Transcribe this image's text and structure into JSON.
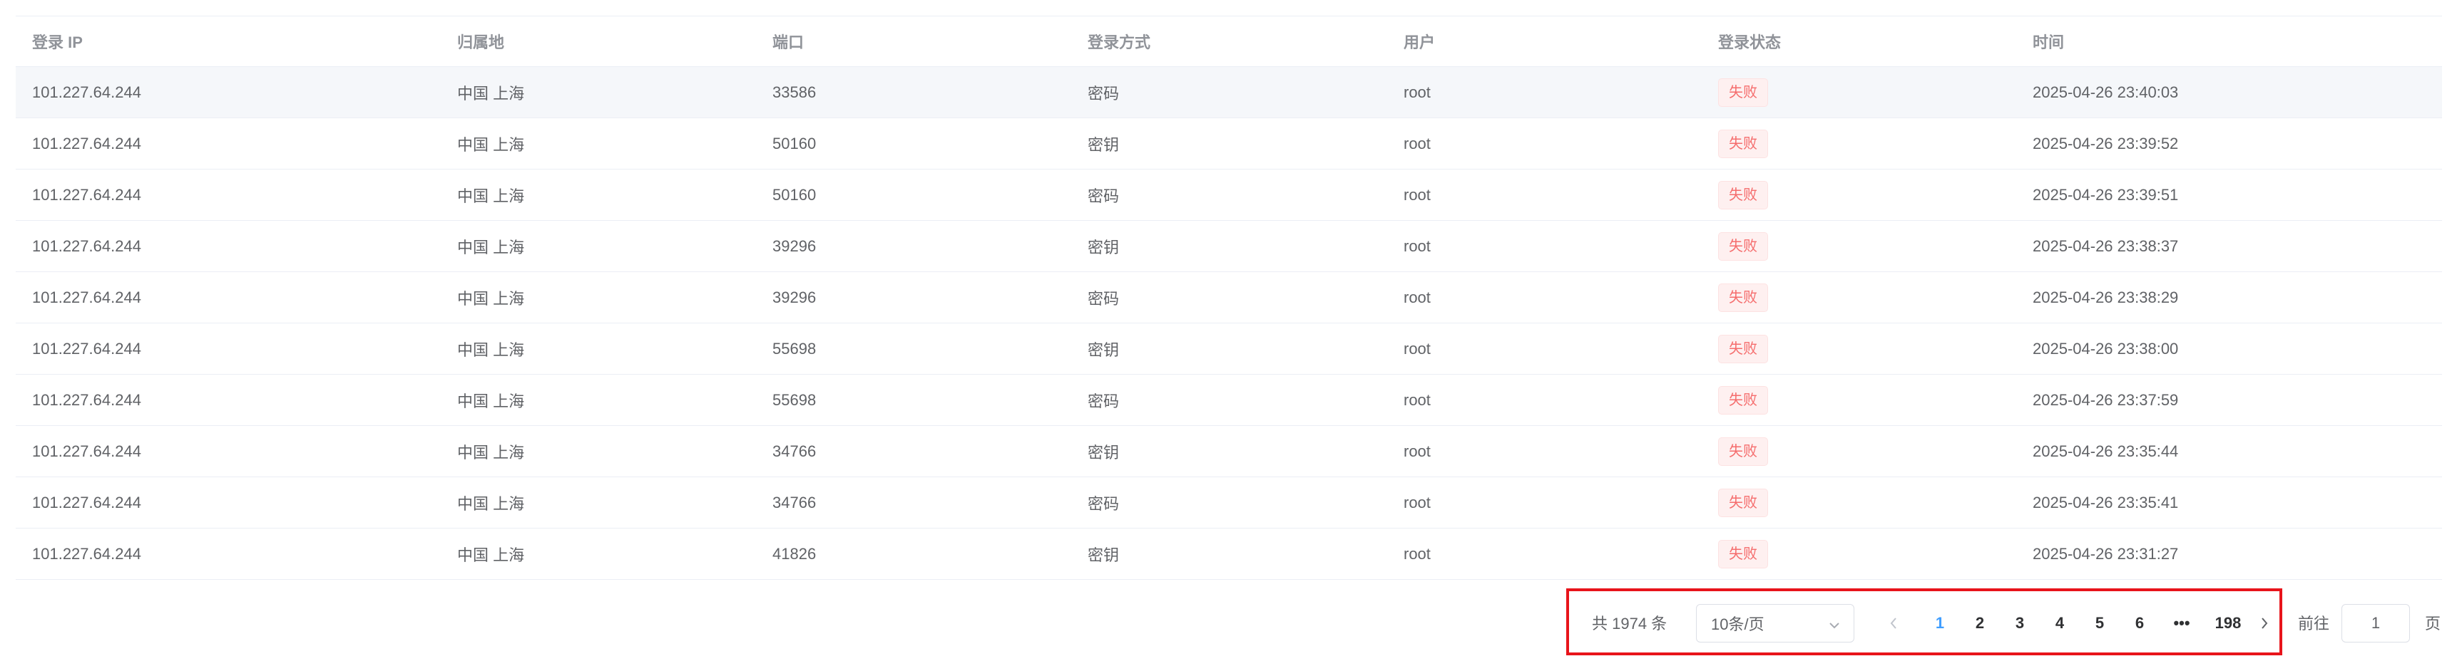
{
  "table": {
    "columns": [
      "登录 IP",
      "归属地",
      "端口",
      "登录方式",
      "用户",
      "登录状态",
      "时间"
    ],
    "rows": [
      {
        "ip": "101.227.64.244",
        "location": "中国 上海",
        "port": "33586",
        "method": "密码",
        "user": "root",
        "status": "失败",
        "time": "2025-04-26 23:40:03"
      },
      {
        "ip": "101.227.64.244",
        "location": "中国 上海",
        "port": "50160",
        "method": "密钥",
        "user": "root",
        "status": "失败",
        "time": "2025-04-26 23:39:52"
      },
      {
        "ip": "101.227.64.244",
        "location": "中国 上海",
        "port": "50160",
        "method": "密码",
        "user": "root",
        "status": "失败",
        "time": "2025-04-26 23:39:51"
      },
      {
        "ip": "101.227.64.244",
        "location": "中国 上海",
        "port": "39296",
        "method": "密钥",
        "user": "root",
        "status": "失败",
        "time": "2025-04-26 23:38:37"
      },
      {
        "ip": "101.227.64.244",
        "location": "中国 上海",
        "port": "39296",
        "method": "密码",
        "user": "root",
        "status": "失败",
        "time": "2025-04-26 23:38:29"
      },
      {
        "ip": "101.227.64.244",
        "location": "中国 上海",
        "port": "55698",
        "method": "密钥",
        "user": "root",
        "status": "失败",
        "time": "2025-04-26 23:38:00"
      },
      {
        "ip": "101.227.64.244",
        "location": "中国 上海",
        "port": "55698",
        "method": "密码",
        "user": "root",
        "status": "失败",
        "time": "2025-04-26 23:37:59"
      },
      {
        "ip": "101.227.64.244",
        "location": "中国 上海",
        "port": "34766",
        "method": "密钥",
        "user": "root",
        "status": "失败",
        "time": "2025-04-26 23:35:44"
      },
      {
        "ip": "101.227.64.244",
        "location": "中国 上海",
        "port": "34766",
        "method": "密码",
        "user": "root",
        "status": "失败",
        "time": "2025-04-26 23:35:41"
      },
      {
        "ip": "101.227.64.244",
        "location": "中国 上海",
        "port": "41826",
        "method": "密钥",
        "user": "root",
        "status": "失败",
        "time": "2025-04-26 23:31:27"
      }
    ]
  },
  "pagination": {
    "total": "共 1974 条",
    "page_size": "10条/页",
    "pages": [
      "1",
      "2",
      "3",
      "4",
      "5",
      "6",
      "•••",
      "198"
    ],
    "current": "1",
    "prev_icon": "chevron-left-icon",
    "next_icon": "chevron-right-icon",
    "goto_label": "前往",
    "goto_value": "1",
    "goto_suffix": "页"
  },
  "colors": {
    "accent": "#409eff",
    "danger": "#f56c6c",
    "highlight_box": "#e8141b"
  }
}
